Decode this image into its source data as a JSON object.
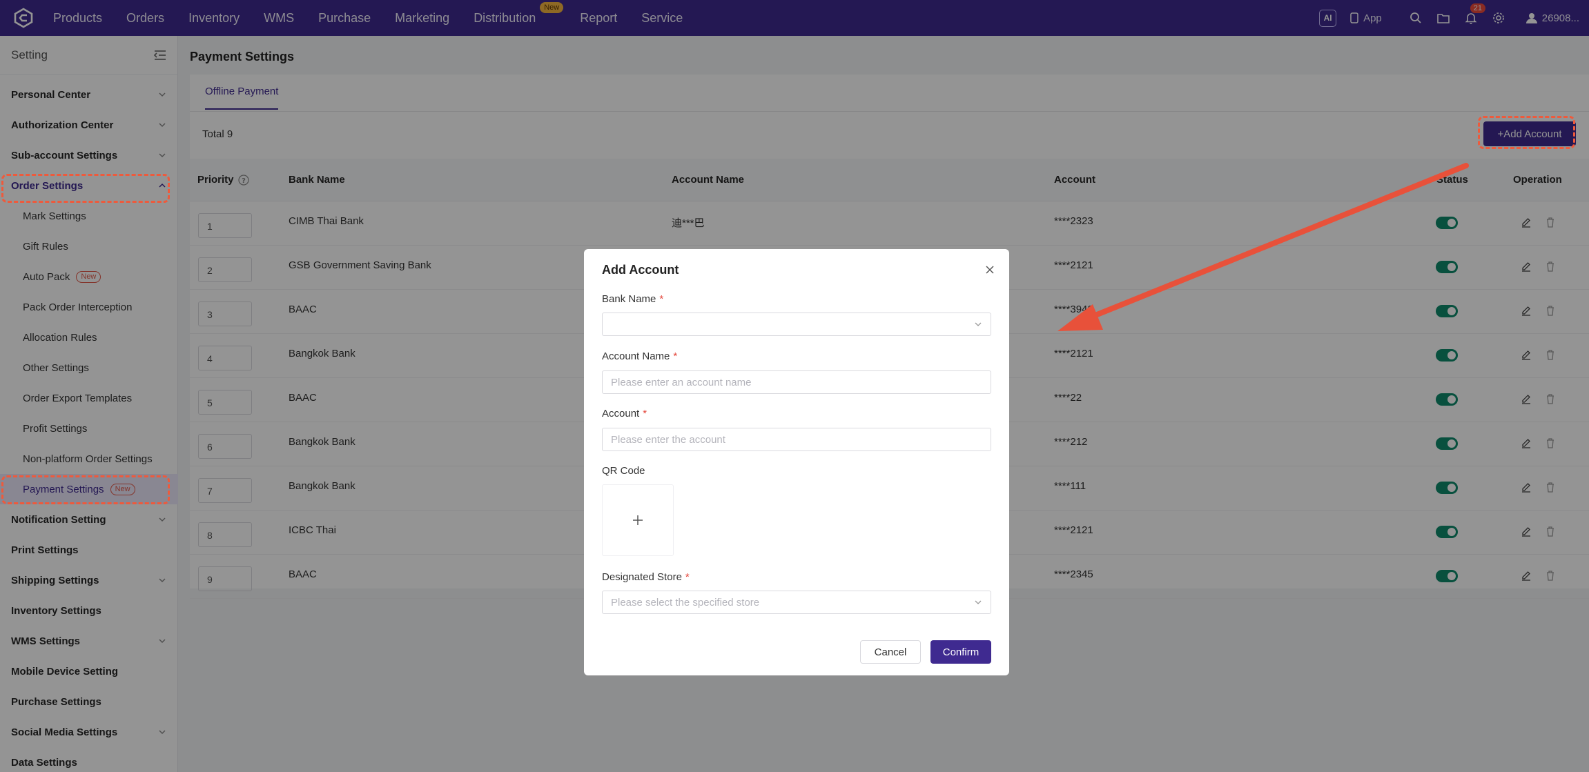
{
  "topbar": {
    "nav": [
      "Products",
      "Orders",
      "Inventory",
      "WMS",
      "Purchase",
      "Marketing",
      "Distribution",
      "Report",
      "Service"
    ],
    "distribution_badge": "New",
    "ai_label": "AI",
    "app_label": "App",
    "notification_count": "21",
    "user": "26908..."
  },
  "sidebar": {
    "title": "Setting",
    "sections": {
      "personal": "Personal Center",
      "authorization": "Authorization Center",
      "subaccount": "Sub-account Settings",
      "order": "Order Settings",
      "notification": "Notification Setting",
      "print": "Print Settings",
      "shipping": "Shipping Settings",
      "inventory": "Inventory Settings",
      "wms": "WMS Settings",
      "mobile": "Mobile Device Setting",
      "purchase": "Purchase Settings",
      "social": "Social Media Settings",
      "data": "Data Settings"
    },
    "order_items": {
      "mark": "Mark Settings",
      "gift": "Gift Rules",
      "autopack": "Auto Pack",
      "interception": "Pack Order Interception",
      "allocation": "Allocation Rules",
      "other": "Other Settings",
      "export": "Order Export Templates",
      "profit": "Profit Settings",
      "nonplatform": "Non-platform Order Settings",
      "payment": "Payment Settings"
    },
    "new_tag": "New"
  },
  "main": {
    "page_title": "Payment Settings",
    "tab": "Offline Payment",
    "total": "Total 9",
    "add_button": "+Add Account",
    "columns": {
      "priority": "Priority",
      "bank": "Bank Name",
      "account_name": "Account Name",
      "account": "Account",
      "status": "Status",
      "operation": "Operation"
    },
    "rows": [
      {
        "priority": "1",
        "bank": "CIMB Thai Bank",
        "account_name": "迪***巴",
        "account": "****2323"
      },
      {
        "priority": "2",
        "bank": "GSB Government Saving Bank",
        "account_name": "",
        "account": "****2121"
      },
      {
        "priority": "3",
        "bank": "BAAC",
        "account_name": "",
        "account": "****3942"
      },
      {
        "priority": "4",
        "bank": "Bangkok Bank",
        "account_name": "",
        "account": "****2121"
      },
      {
        "priority": "5",
        "bank": "BAAC",
        "account_name": "",
        "account": "****22"
      },
      {
        "priority": "6",
        "bank": "Bangkok Bank",
        "account_name": "",
        "account": "****212"
      },
      {
        "priority": "7",
        "bank": "Bangkok Bank",
        "account_name": "",
        "account": "****111"
      },
      {
        "priority": "8",
        "bank": "ICBC Thai",
        "account_name": "",
        "account": "****2121"
      },
      {
        "priority": "9",
        "bank": "BAAC",
        "account_name": "",
        "account": "****2345"
      }
    ]
  },
  "modal": {
    "title": "Add Account",
    "bank_label": "Bank Name",
    "account_name_label": "Account Name",
    "account_name_placeholder": "Please enter an account name",
    "account_label": "Account",
    "account_placeholder": "Please enter the account",
    "qr_label": "QR Code",
    "store_label": "Designated Store",
    "store_placeholder": "Please select the specified store",
    "required_mark": "*",
    "cancel": "Cancel",
    "confirm": "Confirm"
  },
  "colors": {
    "brand": "#3f2a90",
    "highlight": "#ee5a3c",
    "toggle_on": "#0f8a6c"
  }
}
